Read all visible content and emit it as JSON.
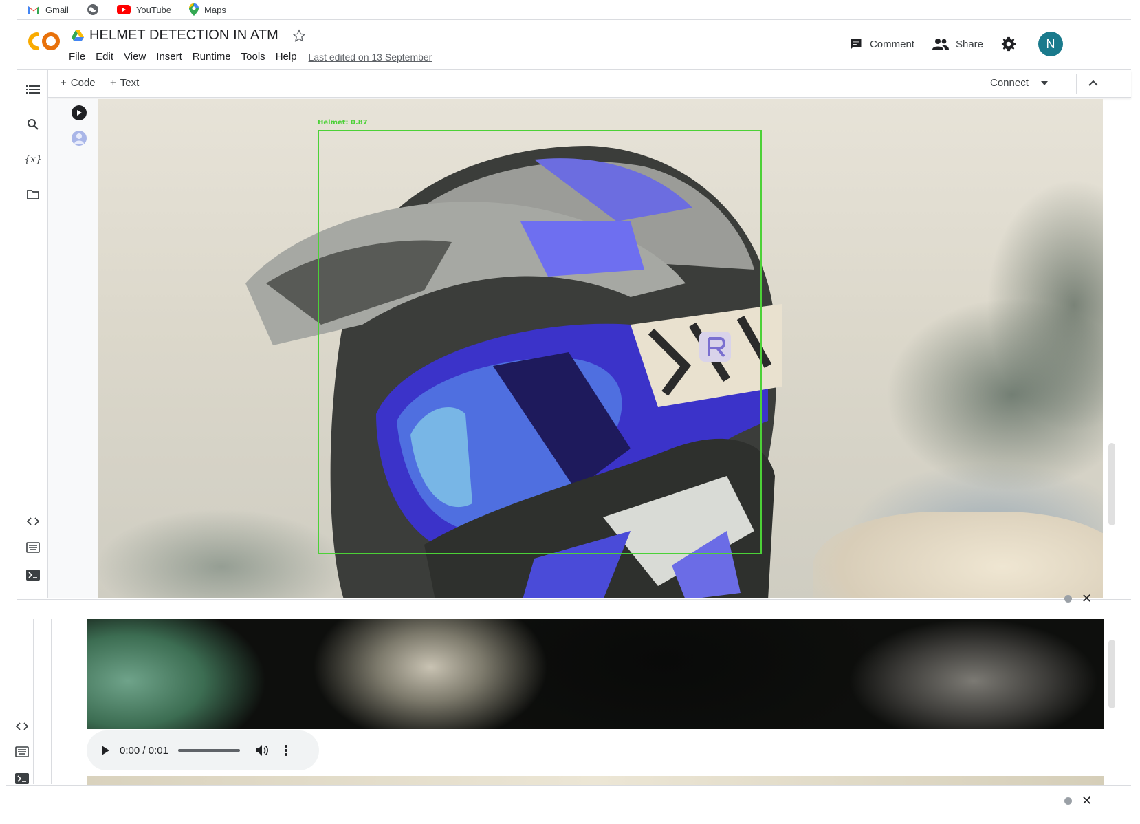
{
  "bookmarks": [
    {
      "label": "Gmail",
      "icon": "gmail-icon"
    },
    {
      "label": "",
      "icon": "globe-icon"
    },
    {
      "label": "YouTube",
      "icon": "youtube-icon"
    },
    {
      "label": "Maps",
      "icon": "maps-icon"
    }
  ],
  "header": {
    "logo_text": "CO",
    "title": "HELMET DETECTION IN ATM",
    "menu": [
      "File",
      "Edit",
      "View",
      "Insert",
      "Runtime",
      "Tools",
      "Help"
    ],
    "last_edited": "Last edited on 13 September",
    "comment_label": "Comment",
    "share_label": "Share",
    "avatar_letter": "N"
  },
  "toolbar": {
    "code_label": "Code",
    "text_label": "Text",
    "connect_label": "Connect"
  },
  "detection": {
    "label": "Helmet: 0.87",
    "color": "#4cd137"
  },
  "audio": {
    "time": "0:00 / 0:01"
  },
  "colors": {
    "accent_orange": "#f9ab00",
    "avatar_bg": "#1a7a8c",
    "detect_green": "#4cd137"
  }
}
